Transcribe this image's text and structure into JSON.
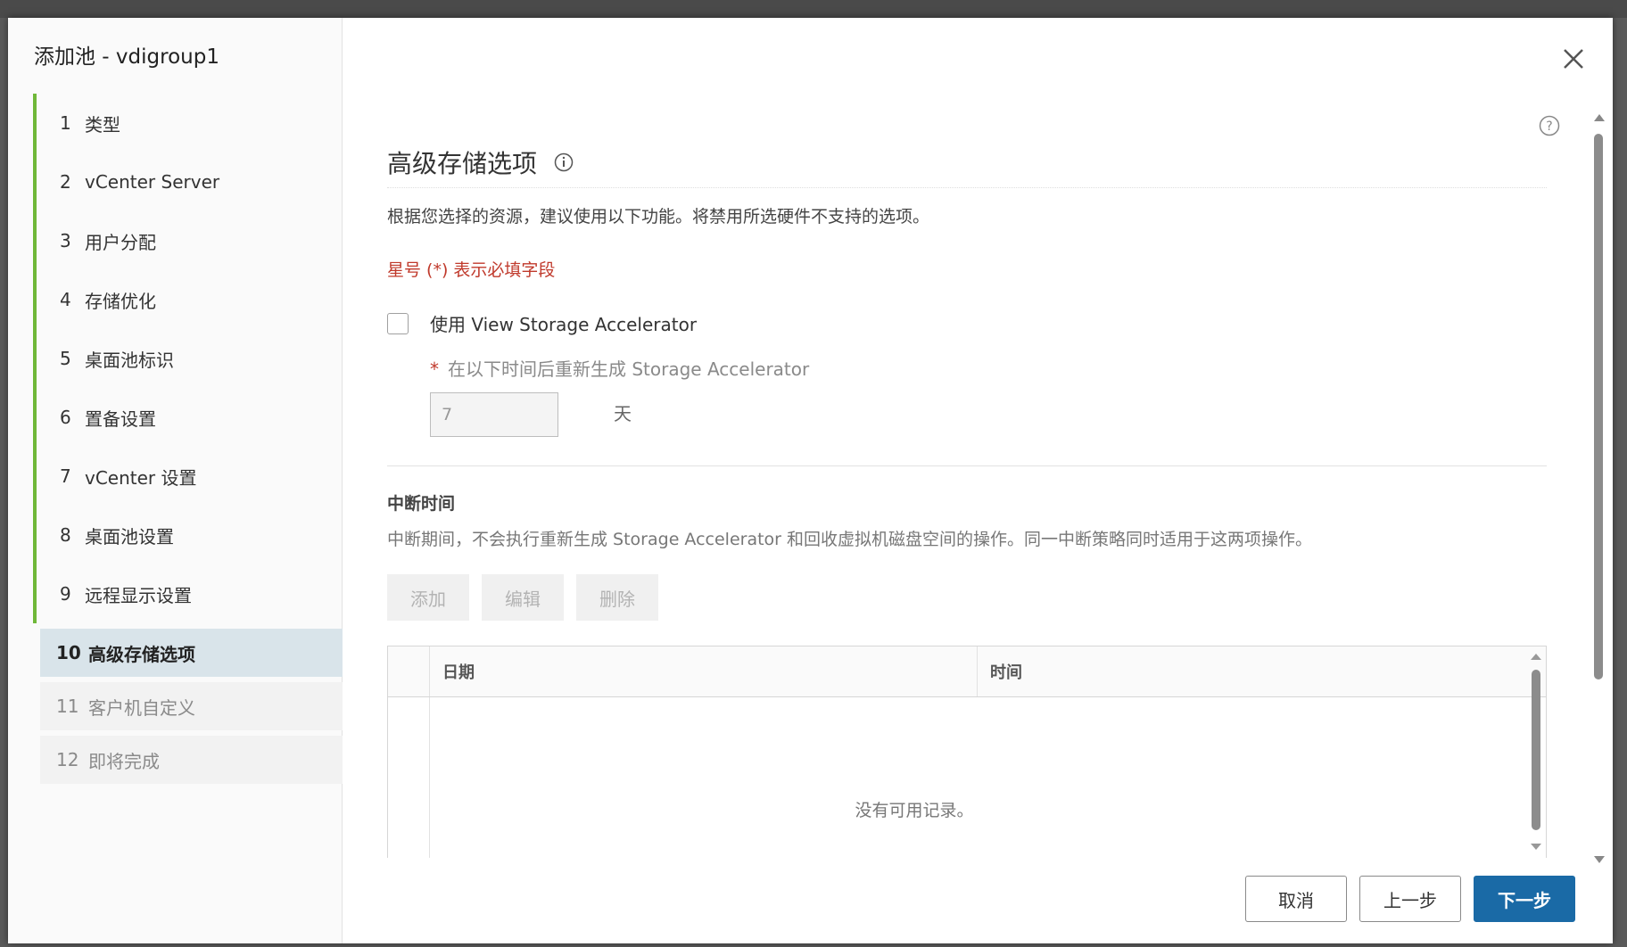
{
  "dialog": {
    "title": "添加池 - vdigroup1"
  },
  "steps": [
    {
      "num": "1",
      "label": "类型",
      "state": "done"
    },
    {
      "num": "2",
      "label": "vCenter Server",
      "state": "done"
    },
    {
      "num": "3",
      "label": "用户分配",
      "state": "done"
    },
    {
      "num": "4",
      "label": "存储优化",
      "state": "done"
    },
    {
      "num": "5",
      "label": "桌面池标识",
      "state": "done"
    },
    {
      "num": "6",
      "label": "置备设置",
      "state": "done"
    },
    {
      "num": "7",
      "label": "vCenter 设置",
      "state": "done"
    },
    {
      "num": "8",
      "label": "桌面池设置",
      "state": "done"
    },
    {
      "num": "9",
      "label": "远程显示设置",
      "state": "done"
    },
    {
      "num": "10",
      "label": "高级存储选项",
      "state": "active"
    },
    {
      "num": "11",
      "label": "客户机自定义",
      "state": "future"
    },
    {
      "num": "12",
      "label": "即将完成",
      "state": "future"
    }
  ],
  "section": {
    "title": "高级存储选项",
    "description": "根据您选择的资源，建议使用以下功能。将禁用所选硬件不支持的选项。",
    "required_note": "星号 (*) 表示必填字段",
    "accelerator_checkbox_label": "使用 View Storage Accelerator",
    "accelerator_checked": false,
    "regen_star": "*",
    "regen_label": "在以下时间后重新生成 Storage Accelerator",
    "regen_days_value": "7",
    "regen_days_unit": "天"
  },
  "blackout": {
    "title": "中断时间",
    "description": "中断期间，不会执行重新生成 Storage Accelerator 和回收虚拟机磁盘空间的操作。同一中断策略同时适用于这两项操作。",
    "add_label": "添加",
    "edit_label": "编辑",
    "delete_label": "删除",
    "columns": [
      "日期",
      "时间"
    ],
    "empty_message": "没有可用记录。"
  },
  "footer": {
    "cancel_label": "取消",
    "back_label": "上一步",
    "next_label": "下一步"
  },
  "colors": {
    "accent": "#1a6aa6",
    "step_done_bar": "#6fb838",
    "required": "#c0392b",
    "active_step_bg": "#d9e4ea"
  },
  "icons": {
    "close": "close-icon",
    "help": "help-circle-icon",
    "info": "info-circle-icon"
  }
}
